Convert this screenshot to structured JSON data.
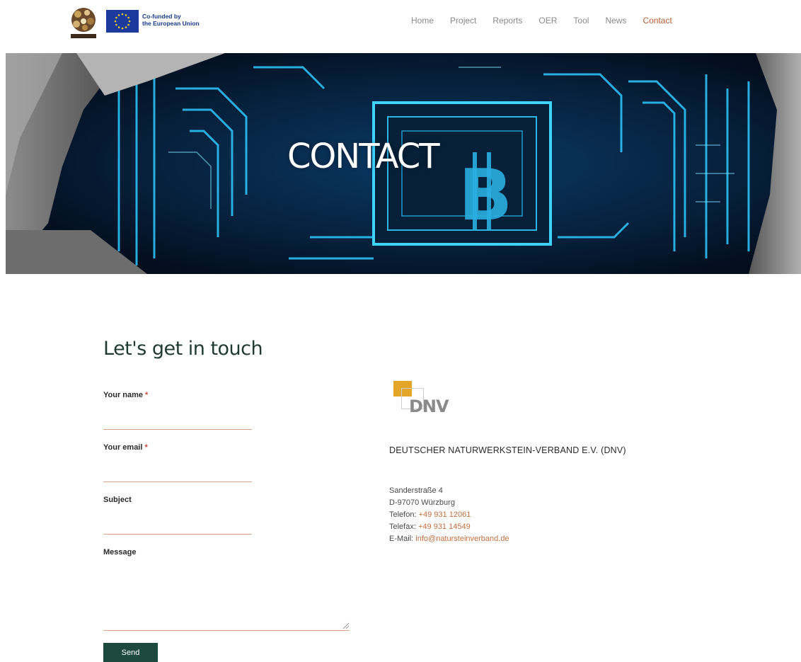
{
  "header": {
    "eu_text_line1": "Co-funded by",
    "eu_text_line2": "the European Union",
    "nav": [
      {
        "label": "Home"
      },
      {
        "label": "Project"
      },
      {
        "label": "Reports"
      },
      {
        "label": "OER"
      },
      {
        "label": "Tool"
      },
      {
        "label": "News"
      },
      {
        "label": "Contact",
        "active": true
      }
    ]
  },
  "hero": {
    "title": "CONTACT"
  },
  "form": {
    "title": "Let's get in touch",
    "name_label": "Your name",
    "email_label": "Your email",
    "subject_label": "Subject",
    "message_label": "Message",
    "required_mark": "*",
    "send_label": "Send"
  },
  "contact": {
    "logo_text": "DNV",
    "org_name": "DEUTSCHER NATURWERKSTEIN-VERBAND E.V. (DNV)",
    "street": "Sanderstraße 4",
    "city": "D-97070 Würzburg",
    "phone_label": "Telefon:",
    "phone": "+49 931 12061",
    "fax_label": "Telefax:",
    "fax": "+49 931 14549",
    "email_label": "E-Mail:",
    "email": "info@natursteinverband.de"
  },
  "colors": {
    "accent": "#b65d33",
    "button": "#1d4a3d",
    "heading": "#1f3a30"
  }
}
